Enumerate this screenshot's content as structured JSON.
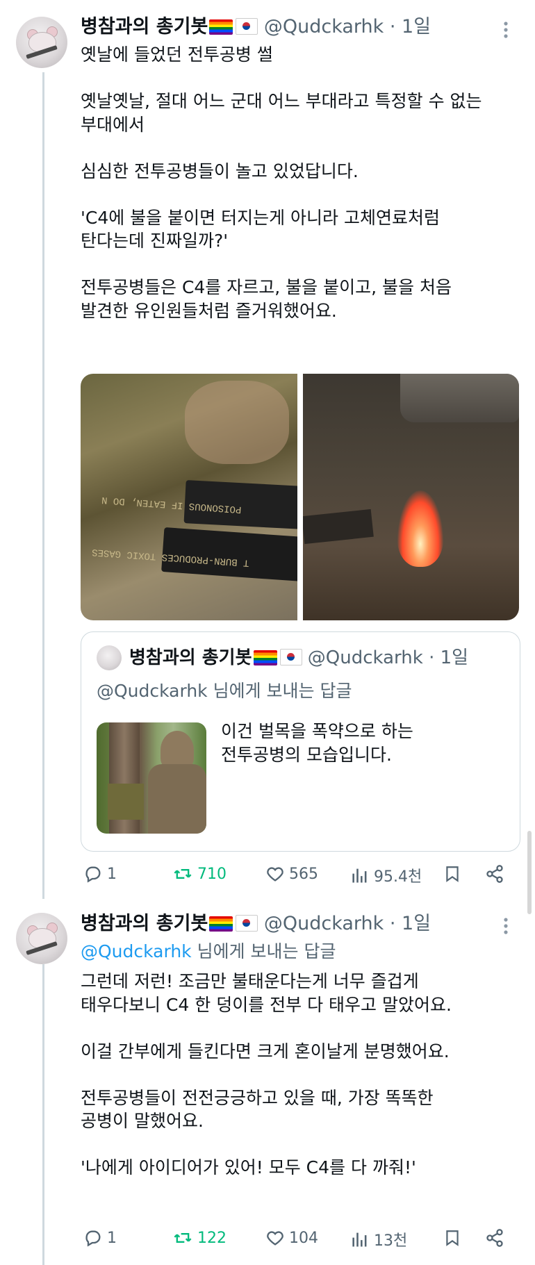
{
  "tweet1": {
    "author_name": "병참과의 총기봇",
    "handle_time": "@Qudckarhk · 1일",
    "more_icon": "more-icon",
    "paragraphs": [
      "옛날에 들었던 전투공병 썰",
      "옛날옛날, 절대 어느 군대 어느 부대라고 특정할 수 없는\n부대에서",
      "심심한 전투공병들이 놀고 있었답니다.",
      "'C4에 불을 붙이면 터지는게 아니라 고체연료처럼\n탄다는데 진짜일까?'",
      "전투공병들은 C4를 자르고, 불을 붙이고, 불을 처음\n발견한 유인원들처럼 즐거워했어요."
    ],
    "image1_stamp_top": "POISONOUS IF EATEN, DO N",
    "image1_stamp_bottom": "T BURN-PRODUCES TOXIC GASES",
    "quote": {
      "author_name": "병참과의 총기봇",
      "handle_time": "@Qudckarhk · 1일",
      "reply_to_handle": "@Qudckarhk",
      "reply_to_suffix": " 님에게 보내는 답글",
      "text_line1": "이건 벌목을 폭약으로 하는",
      "text_line2": "전투공병의 모습입니다."
    },
    "actions": {
      "replies": "1",
      "retweets": "710",
      "likes": "565",
      "views": "95.4천"
    }
  },
  "tweet2": {
    "author_name": "병참과의 총기봇",
    "handle_time": "@Qudckarhk · 1일",
    "reply_to_handle": "@Qudckarhk",
    "reply_to_suffix": " 님에게 보내는 답글",
    "paragraphs": [
      "그런데 저런! 조금만 불태운다는게 너무 즐겁게\n태우다보니 C4 한 덩이를 전부 다 태우고 말았어요.",
      "이걸 간부에게 들킨다면 크게 혼이날게 분명했어요.",
      "전투공병들이 전전긍긍하고 있을 때, 가장 똑똑한\n공병이 말했어요.",
      "'나에게 아이디어가 있어! 모두 C4를 다 까줘!'"
    ],
    "actions": {
      "replies": "1",
      "retweets": "122",
      "likes": "104",
      "views": "13천"
    }
  },
  "colors": {
    "accent": "#1d9bf0",
    "retweet": "#00ba7c",
    "secondary_text": "#536471",
    "border": "#cfd9de"
  }
}
